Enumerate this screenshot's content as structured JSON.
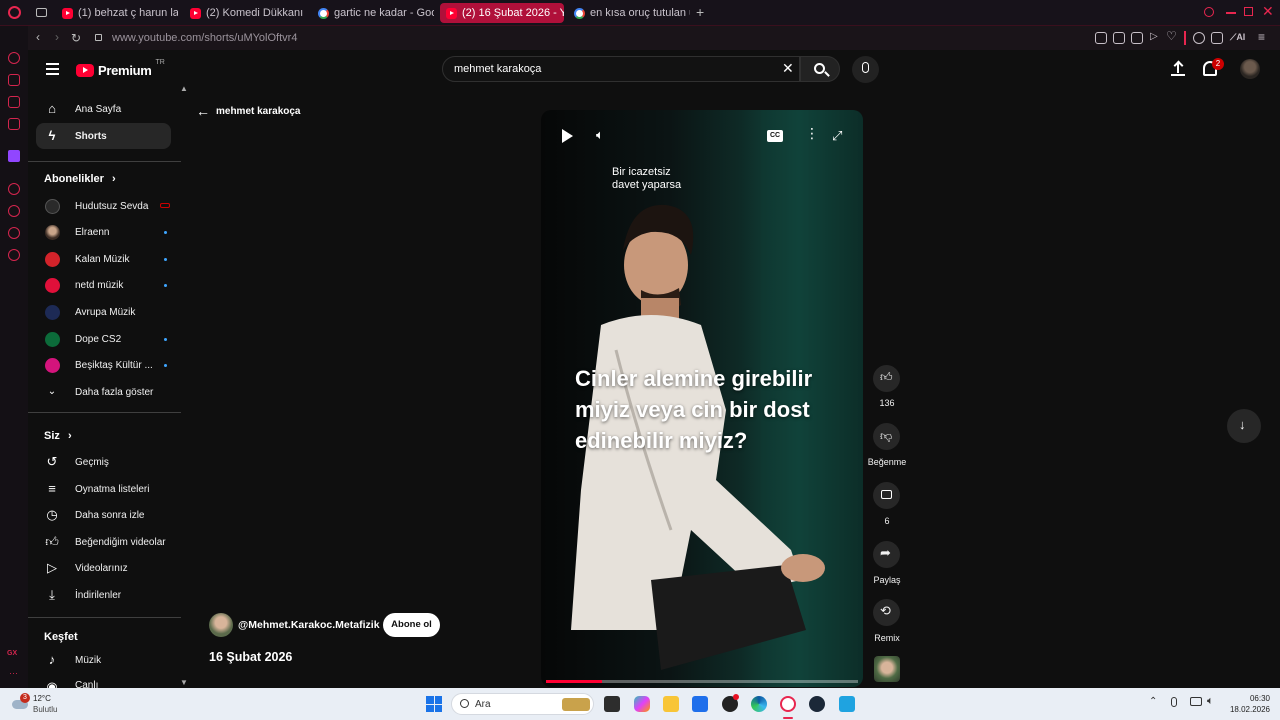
{
  "browser": {
    "tabs": [
      {
        "title": "(1) behzat ç harun laf sokm",
        "favicon": "youtube-icon",
        "active": false
      },
      {
        "title": "(2) Komedi Dükkanı - 55. B",
        "favicon": "youtube-icon",
        "active": false
      },
      {
        "title": "gartic ne kadar - Google'd",
        "favicon": "google-icon",
        "active": false
      },
      {
        "title": "(2) 16 Şubat 2026 - YouTu",
        "favicon": "youtube-icon",
        "active": true
      },
      {
        "title": "en kısa oruç tutulan ülke -",
        "favicon": "google-icon",
        "active": false
      }
    ],
    "url": "www.youtube.com/shorts/uMYolOftvr4",
    "ai_label": "AI",
    "accent": "#b0103a"
  },
  "youtube": {
    "logo_text": "Premium",
    "logo_superscript": "TR",
    "search_value": "mehmet karakoça",
    "notification_count": "2",
    "sidebar": {
      "main": [
        {
          "label": "Ana Sayfa",
          "icon": "home-icon"
        },
        {
          "label": "Shorts",
          "icon": "shorts-icon",
          "active": true
        }
      ],
      "subscriptions_title": "Abonelikler",
      "subscriptions": [
        {
          "label": "Hudutsuz Sevda",
          "color": "#2a2a2a"
        },
        {
          "label": "Elraenn",
          "color": "#5b4a3f"
        },
        {
          "label": "Kalan Müzik",
          "color": "#d2232a"
        },
        {
          "label": "netd müzik",
          "color": "#e0103a"
        },
        {
          "label": "Avrupa Müzik",
          "color": "#1d2a55"
        },
        {
          "label": "Dope CS2",
          "color": "#0c6b3a"
        },
        {
          "label": "Beşiktaş Kültür ...",
          "color": "#d4147c"
        }
      ],
      "show_more": "Daha fazla göster",
      "you_title": "Siz",
      "you": [
        {
          "label": "Geçmiş",
          "icon": "history-icon"
        },
        {
          "label": "Oynatma listeleri",
          "icon": "playlist-icon"
        },
        {
          "label": "Daha sonra izle",
          "icon": "clock-icon"
        },
        {
          "label": "Beğendiğim videolar",
          "icon": "like-icon"
        },
        {
          "label": "Videolarınız",
          "icon": "video-icon"
        },
        {
          "label": "İndirilenler",
          "icon": "download-icon"
        }
      ],
      "explore_title": "Keşfet",
      "explore": [
        {
          "label": "Müzik",
          "icon": "music-icon"
        },
        {
          "label": "Canlı",
          "icon": "live-icon"
        }
      ]
    },
    "back_label": "mehmet karakoça",
    "short": {
      "top_caption": "Bir icazetsiz\ndavet yaparsa",
      "overlay_text": "Cinler alemine girebilir miyiz veya cin bir dost edinebilir miyiz?",
      "cc_label": "CC",
      "progress": 0.18,
      "channel": "@Mehmet.Karakoc.Metafizik",
      "subscribe_label": "Abone ol",
      "date": "16 Şubat 2026"
    },
    "actions": {
      "like_count": "136",
      "dislike_label": "Beğenme",
      "comment_count": "6",
      "share_label": "Paylaş",
      "remix_label": "Remix"
    }
  },
  "taskbar": {
    "weather_badge": "3",
    "temperature": "12°C",
    "weather_desc": "Bulutlu",
    "search_label": "Ara",
    "time": "06:30",
    "date": "18.02.2026"
  }
}
